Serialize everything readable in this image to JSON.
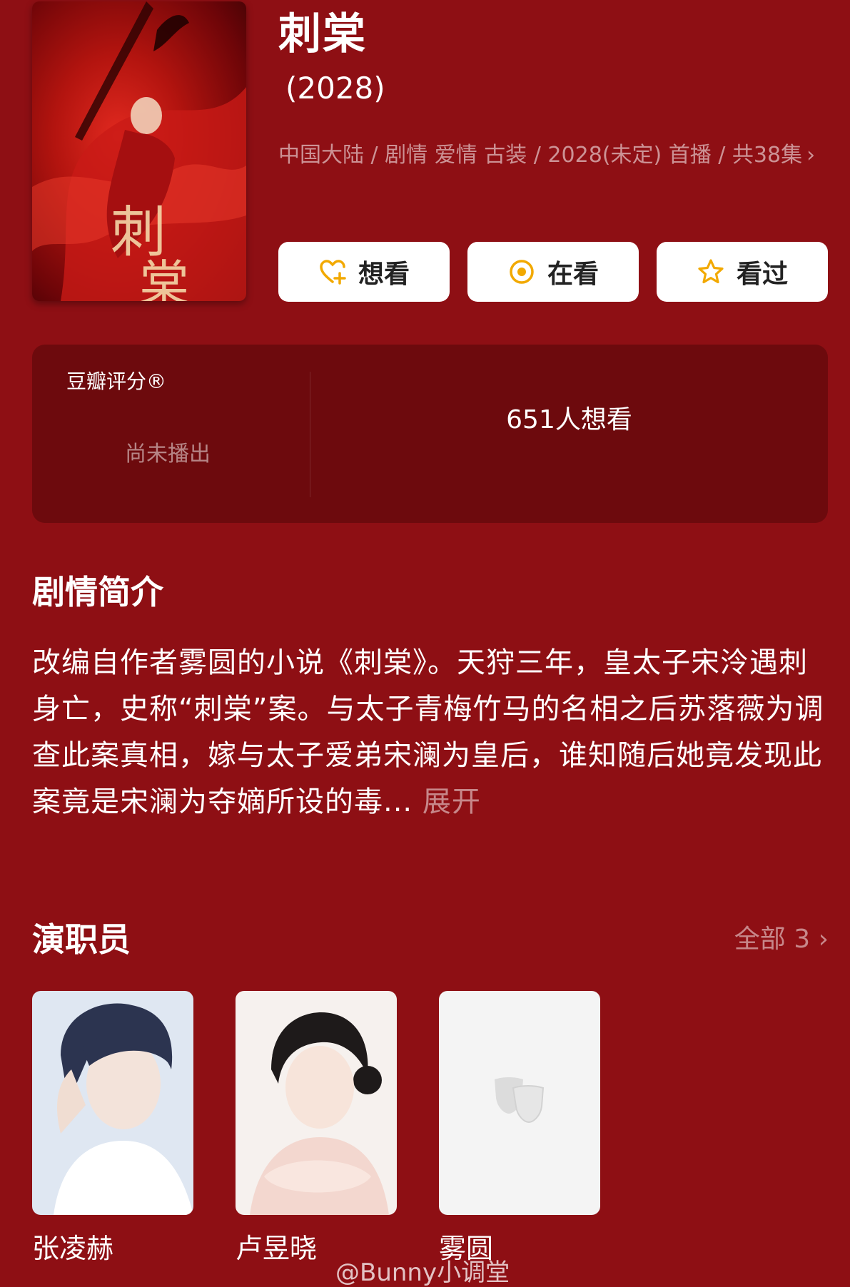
{
  "show": {
    "title": "刺棠",
    "year": "(2028)",
    "meta": "中国大陆 / 剧情 爱情 古装 / 2028(未定) 首播 / 共38集",
    "meta_chevron": "›"
  },
  "actions": {
    "want_label": "想看",
    "watching_label": "在看",
    "watched_label": "看过"
  },
  "rating": {
    "label": "豆瓣评分®",
    "status": "尚未播出",
    "want_count": "651人想看"
  },
  "synopsis": {
    "heading": "剧情简介",
    "text": "改编自作者雾圆的小说《刺棠》。天狩三年，皇太子宋泠遇刺身亡，史称“刺棠”案。与太子青梅竹马的名相之后苏落薇为调查此案真相，嫁与太子爱弟宋澜为皇后，谁知随后她竟发现此案竟是宋澜为夺嫡所设的毒...",
    "expand_label": "展开"
  },
  "cast": {
    "heading": "演职员",
    "all_label": "全部 3 ›",
    "members": [
      {
        "name": "张凌赫"
      },
      {
        "name": "卢昱晓"
      },
      {
        "name": "雾圆"
      }
    ]
  },
  "watermark": "@Bunny小调堂",
  "colors": {
    "background": "#8e0f14",
    "card": "#6d0a0d",
    "accent": "#f2a900"
  }
}
